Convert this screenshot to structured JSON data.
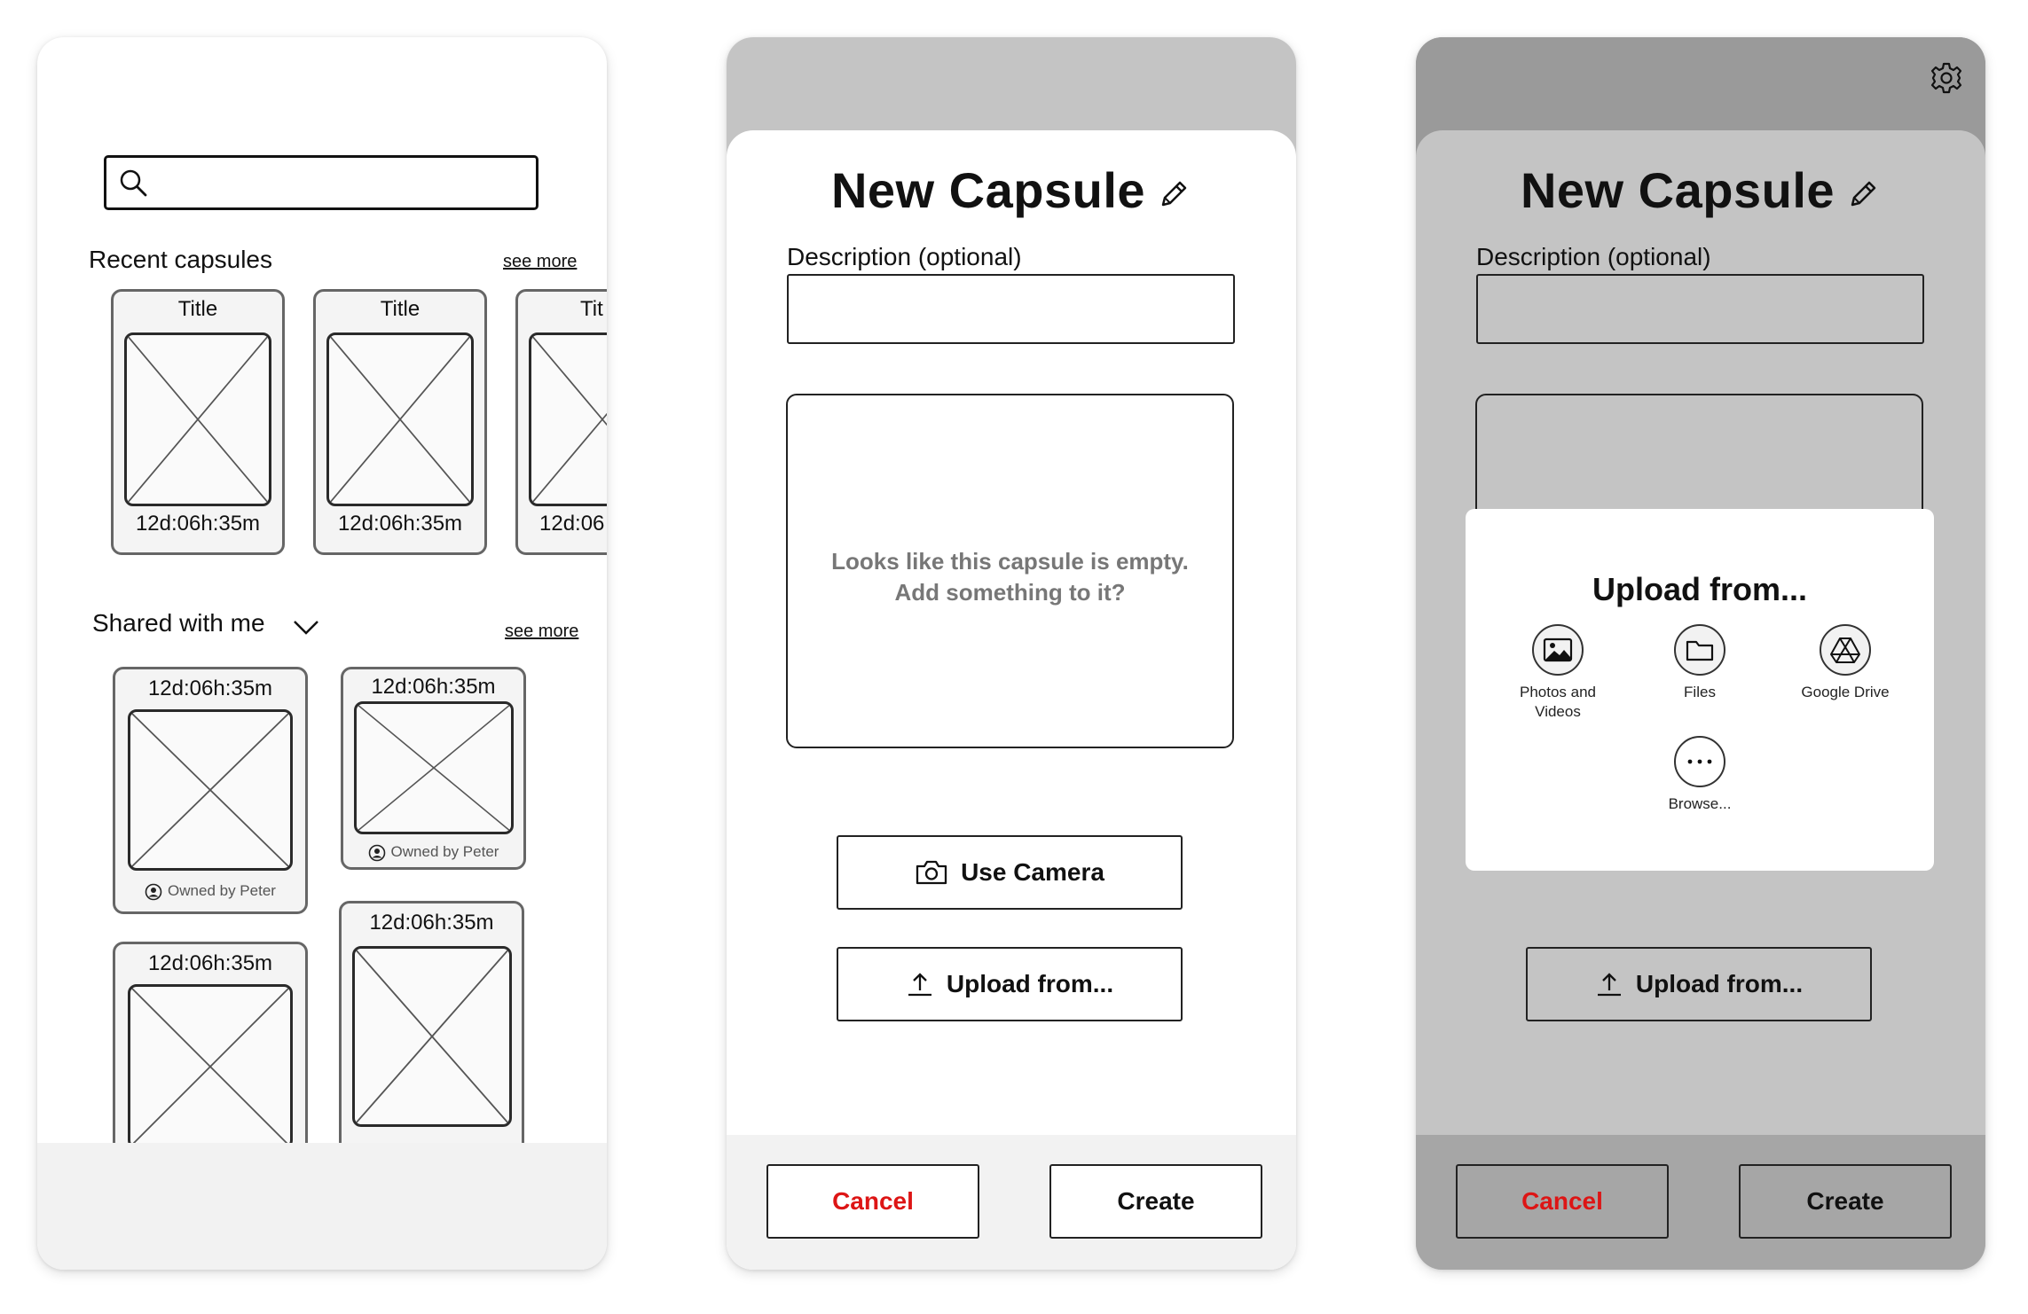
{
  "colors": {
    "cancel_red": "#dd1515",
    "dim_overlay": "#c4c4c4",
    "panel_white": "#ffffff",
    "footer_gray": "#f2f2f2"
  },
  "phone1": {
    "search": {
      "placeholder": "",
      "icon": "search-icon"
    },
    "recent": {
      "title": "Recent capsules",
      "see_more": "see more",
      "cards": [
        {
          "title": "Title",
          "time": "12d:06h:35m"
        },
        {
          "title": "Title",
          "time": "12d:06h:35m"
        },
        {
          "title": "Tit",
          "time": "12d:06"
        }
      ]
    },
    "shared": {
      "title": "Shared with me",
      "see_more": "see more",
      "cards": [
        {
          "time": "12d:06h:35m",
          "owner": "Owned by Peter"
        },
        {
          "time": "12d:06h:35m",
          "owner": "Owned by Peter"
        },
        {
          "time": "12d:06h:35m",
          "owner": ""
        },
        {
          "time": "12d:06h:35m",
          "owner": ""
        }
      ]
    }
  },
  "phone2": {
    "title": "New Capsule",
    "description_label": "Description (optional)",
    "description_value": "",
    "empty_line1": "Looks like this capsule is empty.",
    "empty_line2": "Add something to it?",
    "use_camera": "Use Camera",
    "upload_from": "Upload from...",
    "cancel": "Cancel",
    "create": "Create"
  },
  "phone3": {
    "title": "New Capsule",
    "description_label": "Description (optional)",
    "modal": {
      "title": "Upload from...",
      "options": [
        {
          "line1": "Photos and",
          "line2": "Videos",
          "icon": "image-icon"
        },
        {
          "line1": "Files",
          "line2": "",
          "icon": "folder-icon"
        },
        {
          "line1": "Google Drive",
          "line2": "",
          "icon": "google-drive-icon"
        },
        {
          "line1": "Browse...",
          "line2": "",
          "icon": "more-icon"
        }
      ]
    },
    "upload_from": "Upload from...",
    "cancel": "Cancel",
    "create": "Create"
  }
}
